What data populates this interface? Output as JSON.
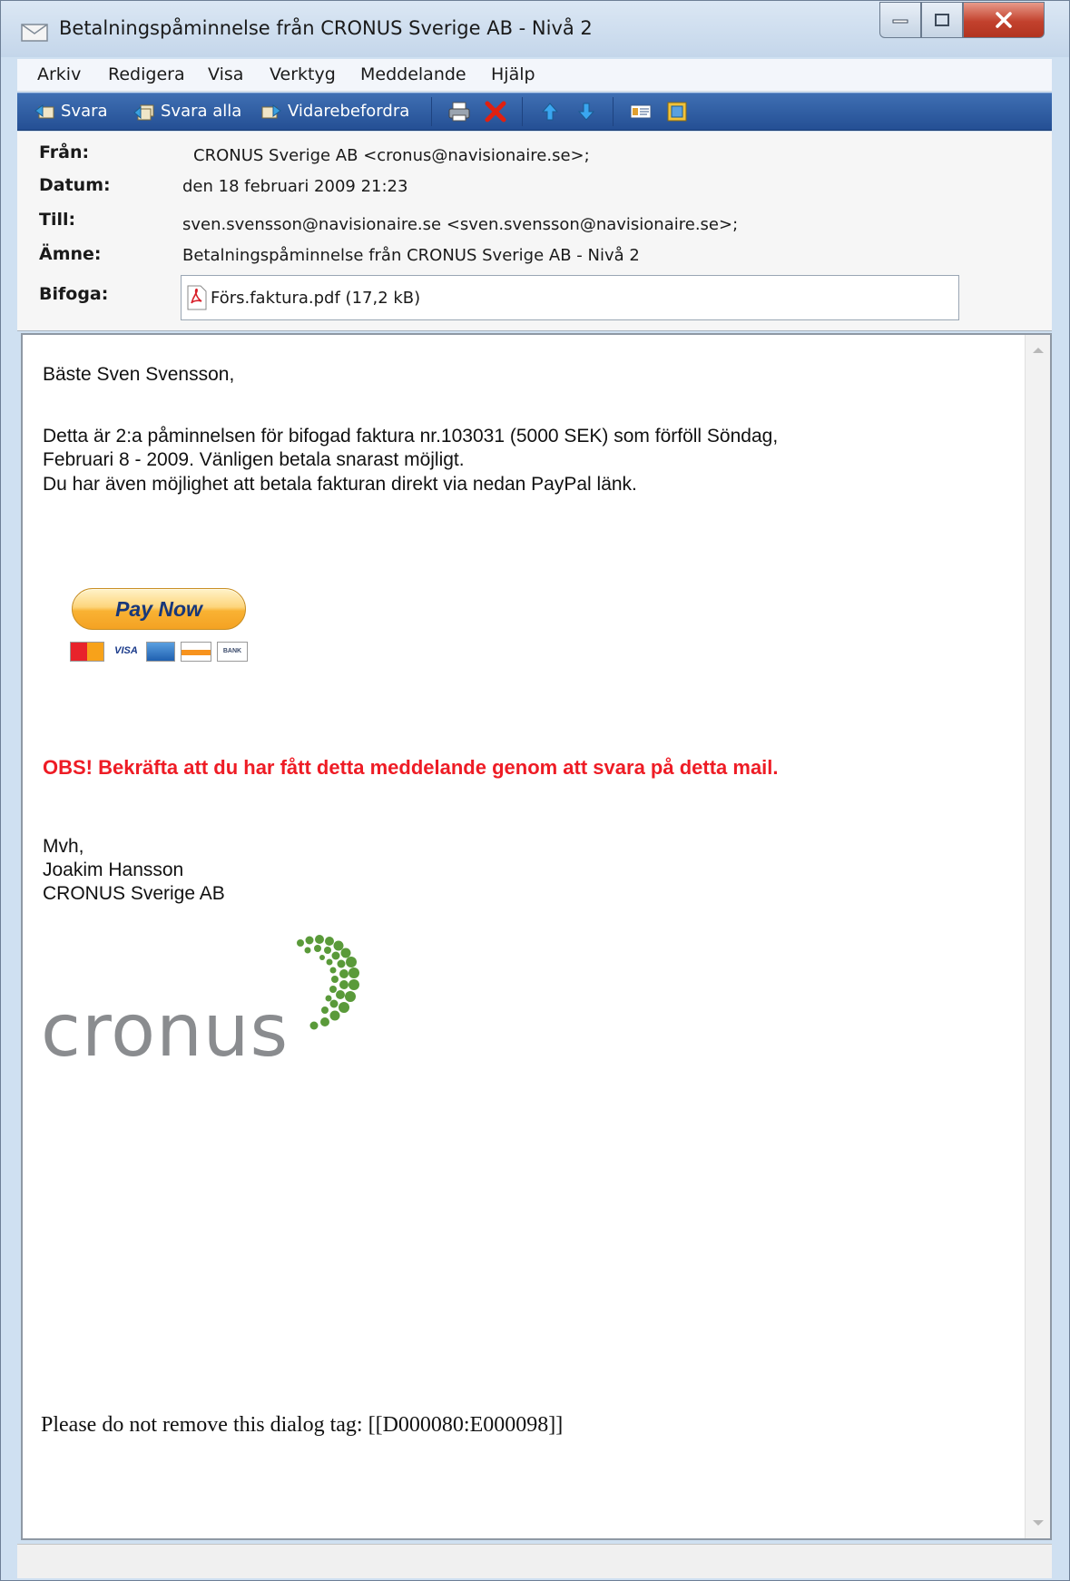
{
  "window": {
    "title": "Betalningspåminnelse från CRONUS Sverige AB - Nivå 2"
  },
  "menu": [
    "Arkiv",
    "Redigera",
    "Visa",
    "Verktyg",
    "Meddelande",
    "Hjälp"
  ],
  "toolbar": {
    "reply": "Svara",
    "reply_all": "Svara alla",
    "forward": "Vidarebefordra"
  },
  "header": {
    "from_label": "Från:",
    "from_value": "CRONUS Sverige AB   <cronus@navisionaire.se>;",
    "date_label": "Datum:",
    "date_value": "den 18 februari 2009 21:23",
    "to_label": "Till:",
    "to_value": "sven.svensson@navisionaire.se <sven.svensson@navisionaire.se>;",
    "subject_label": "Ämne:",
    "subject_value": "Betalningspåminnelse från CRONUS Sverige AB - Nivå 2",
    "attach_label": "Bifoga:",
    "attachment": "Förs.faktura.pdf (17,2 kB)"
  },
  "body": {
    "greeting": "Bäste Sven Svensson,",
    "line1": "Detta är 2:a påminnelsen för bifogad faktura nr.103031 (5000 SEK) som förföll Söndag,",
    "line2": "Februari 8 - 2009. Vänligen betala snarast möjligt.",
    "line3": "Du har även möjlighet att betala fakturan direkt via nedan PayPal länk.",
    "paynow": "Pay Now",
    "cards": [
      "VISA",
      "BANK"
    ],
    "notice": "OBS! Bekräfta att du har fått detta meddelande genom att svara på detta mail.",
    "closing": "Mvh,",
    "signer": "Joakim Hansson",
    "company": "CRONUS Sverige AB",
    "logo_text": "cronus",
    "dialog_tag": "Please do not remove this dialog tag: [[D000080:E000098]]"
  },
  "colors": {
    "toolbar": "#2d5aa0",
    "notice_red": "#ee1c25",
    "logo_gray": "#8a8c8f",
    "logo_green": "#5a9a3a"
  }
}
